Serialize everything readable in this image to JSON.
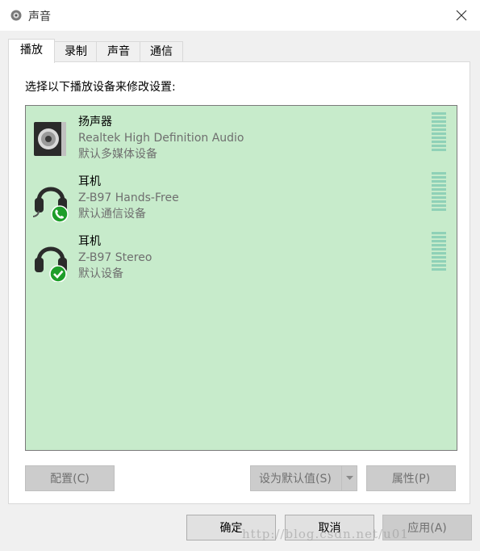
{
  "window": {
    "title": "声音",
    "close_icon": "close-icon"
  },
  "tabs": [
    {
      "label": "播放",
      "active": true
    },
    {
      "label": "录制",
      "active": false
    },
    {
      "label": "声音",
      "active": false
    },
    {
      "label": "通信",
      "active": false
    }
  ],
  "panel": {
    "instruction": "选择以下播放设备来修改设置:"
  },
  "devices": [
    {
      "name": "扬声器",
      "driver": "Realtek High Definition Audio",
      "status": "默认多媒体设备",
      "icon": "speaker-icon"
    },
    {
      "name": "耳机",
      "driver": "Z-B97 Hands-Free",
      "status": "默认通信设备",
      "icon": "headset-phone-icon"
    },
    {
      "name": "耳机",
      "driver": "Z-B97 Stereo",
      "status": "默认设备",
      "icon": "headset-check-icon"
    }
  ],
  "panel_buttons": {
    "configure": "配置(C)",
    "set_default": "设为默认值(S)",
    "properties": "属性(P)"
  },
  "dialog_buttons": {
    "ok": "确定",
    "cancel": "取消",
    "apply": "应用(A)"
  },
  "watermark": "http://blog.csdn.net/u01",
  "colors": {
    "list_bg": "#c7ebcb",
    "level_bar": "#8fd1b7",
    "badge_green": "#1e9e2a"
  }
}
